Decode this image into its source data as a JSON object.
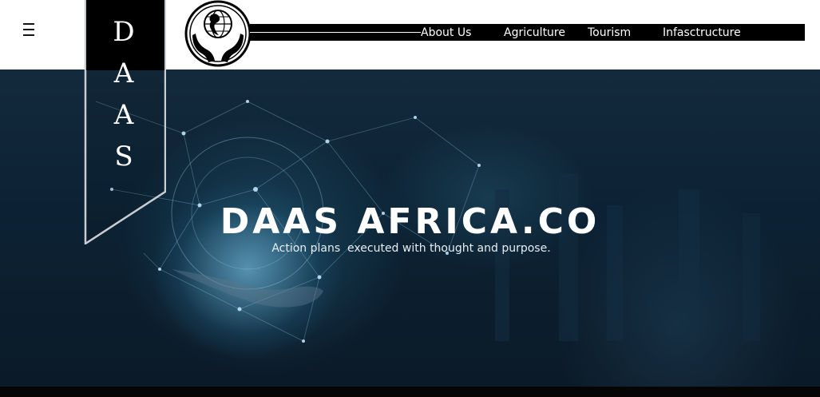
{
  "header": {
    "menu_icon": "hamburger-menu-icon",
    "logo_icon": "globe-in-hands-icon",
    "nav": [
      {
        "label": "About Us"
      },
      {
        "label": "Agriculture"
      },
      {
        "label": "Tourism"
      },
      {
        "label": "Infasctructure"
      }
    ]
  },
  "banner": {
    "letters": [
      "D",
      "A",
      "A",
      "S"
    ]
  },
  "hero": {
    "title": "DAAS AFRICA.CO",
    "subtitle": "Action plans  executed with thought and purpose."
  },
  "colors": {
    "header_bg": "#ffffff",
    "nav_bg": "#000000",
    "nav_text": "#ffffff",
    "hero_bg": "#0e2333",
    "footer_strip": "#050505"
  }
}
